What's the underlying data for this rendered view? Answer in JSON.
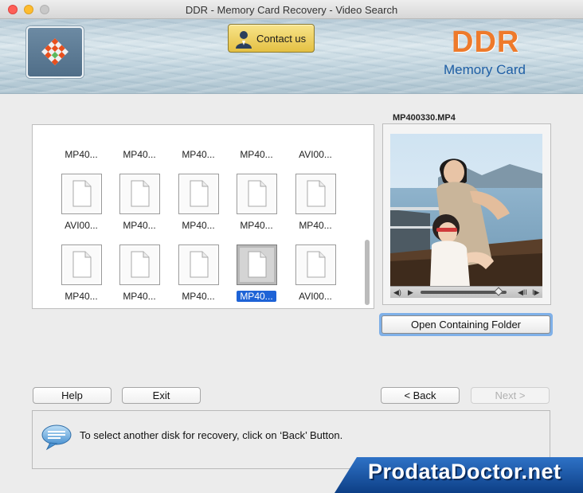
{
  "window": {
    "title": "DDR - Memory Card Recovery - Video Search"
  },
  "header": {
    "contact_label": "Contact us",
    "brand_name": "DDR",
    "brand_subtitle": "Memory Card",
    "logo_icon": "checkered-diamond-logo",
    "contact_icon": "person-icon"
  },
  "grid": {
    "rows": [
      [
        "MP40...",
        "MP40...",
        "MP40...",
        "MP40...",
        "AVI00..."
      ],
      [
        "AVI00...",
        "MP40...",
        "MP40...",
        "MP40...",
        "MP40..."
      ],
      [
        "MP40...",
        "MP40...",
        "MP40...",
        "MP40...",
        "AVI00..."
      ]
    ],
    "selected": "MP40..."
  },
  "preview": {
    "filename": "MP400330.MP4",
    "open_folder_label": "Open Containing Folder"
  },
  "buttons": {
    "help": "Help",
    "exit": "Exit",
    "back": "< Back",
    "next": "Next >"
  },
  "info": {
    "message": "To select another disk for recovery, click on ‘Back’ Button."
  },
  "watermark": {
    "text": "ProdataDoctor.net"
  },
  "colors": {
    "accent": "#1e63d6",
    "brand_orange": "#ee7a2b",
    "brand_blue": "#1f5fa5",
    "focus_ring": "#7fb0e8"
  }
}
